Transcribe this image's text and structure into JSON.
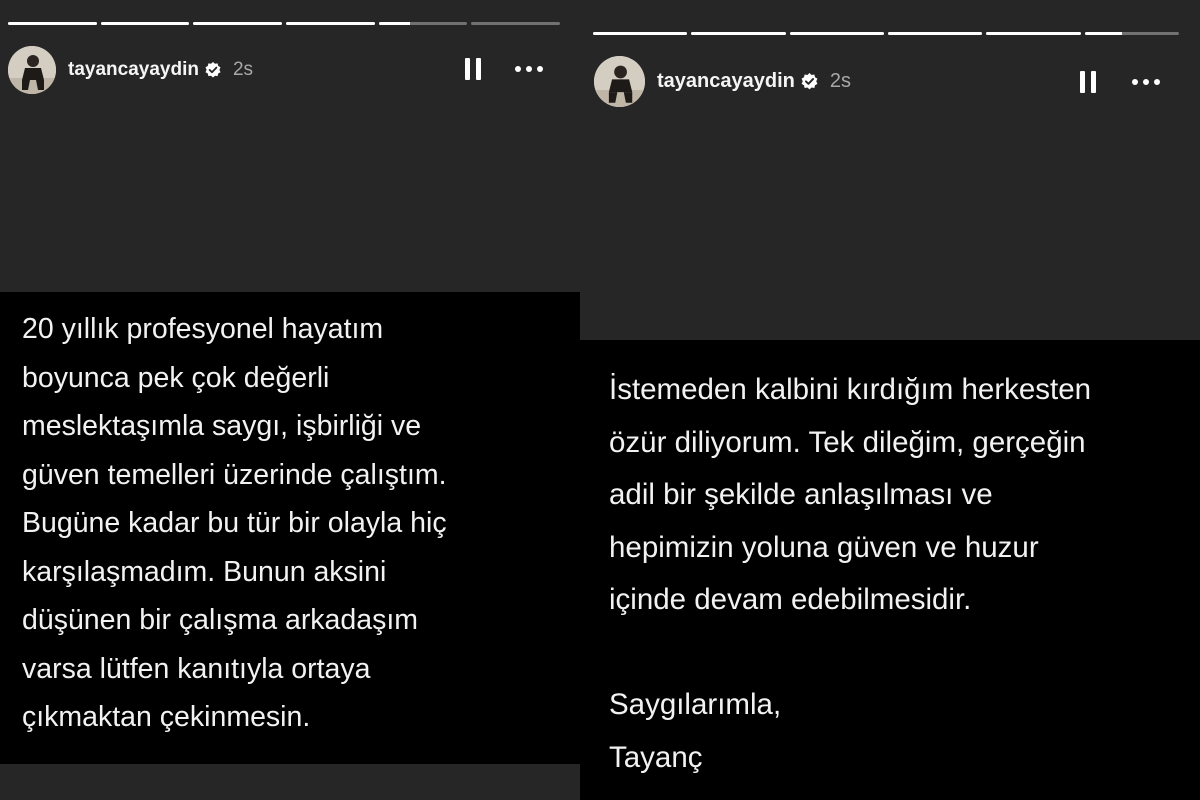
{
  "left_story": {
    "username": "tayancayaydin",
    "time_ago": "2s",
    "progress": [
      1,
      1,
      1,
      1,
      0.35,
      0
    ],
    "text_lines": [
      "20 yıllık profesyonel hayatım",
      "boyunca pek çok değerli",
      "meslektaşımla saygı, işbirliği ve",
      "güven temelleri üzerinde çalıştım.",
      "Bugüne kadar bu tür bir olayla hiç",
      "karşılaşmadım. Bunun aksini",
      "düşünen bir çalışma arkadaşım",
      "varsa lütfen kanıtıyla ortaya",
      "çıkmaktan çekinmesin."
    ]
  },
  "right_story": {
    "username": "tayancayaydin",
    "time_ago": "2s",
    "progress": [
      1,
      1,
      1,
      1,
      1,
      0.4
    ],
    "text_lines": [
      "İstemeden kalbini kırdığım herkesten",
      "özür diliyorum. Tek dileğim, gerçeğin",
      "adil bir şekilde anlaşılması ve",
      "hepimizin yoluna güven ve huzur",
      "içinde devam edebilmesidir."
    ],
    "closing": "Saygılarımla,",
    "signature": "Tayanç"
  },
  "icons": {
    "verified": "verified-badge-icon",
    "pause": "pause-icon",
    "more": "more-options-icon"
  },
  "colors": {
    "background": "#262626",
    "text_block": "#000000",
    "text": "#f2f2f2",
    "muted": "#a8a8a8"
  }
}
